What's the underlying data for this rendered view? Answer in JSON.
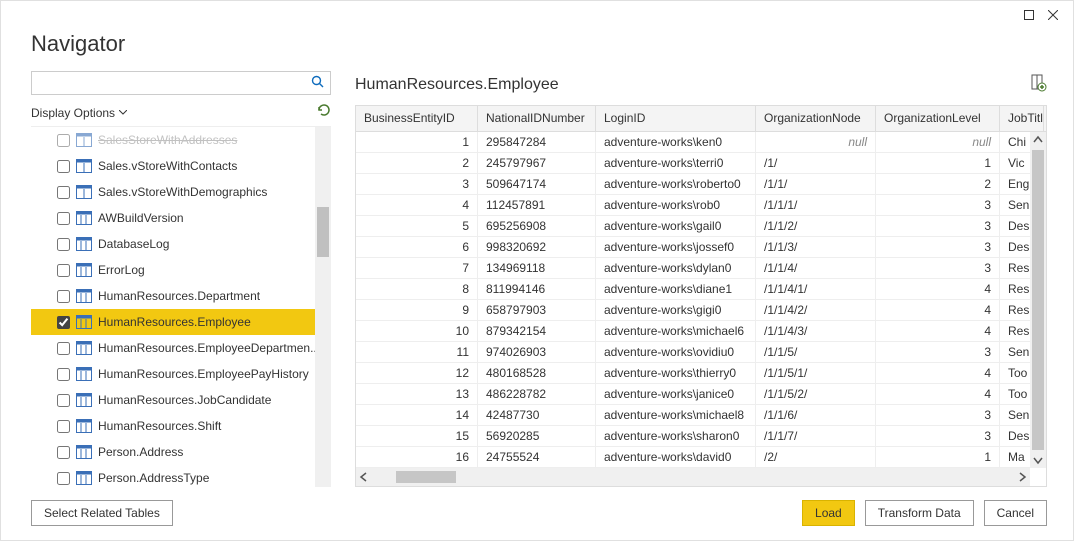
{
  "window": {
    "title": "Navigator"
  },
  "left": {
    "search_placeholder": "",
    "display_options": "Display Options",
    "tree": [
      {
        "label": "SalesStoreWithAddresses",
        "kind": "view",
        "checked": false,
        "faded": true
      },
      {
        "label": "Sales.vStoreWithContacts",
        "kind": "view",
        "checked": false
      },
      {
        "label": "Sales.vStoreWithDemographics",
        "kind": "view",
        "checked": false
      },
      {
        "label": "AWBuildVersion",
        "kind": "table",
        "checked": false
      },
      {
        "label": "DatabaseLog",
        "kind": "table",
        "checked": false
      },
      {
        "label": "ErrorLog",
        "kind": "table",
        "checked": false
      },
      {
        "label": "HumanResources.Department",
        "kind": "table",
        "checked": false
      },
      {
        "label": "HumanResources.Employee",
        "kind": "table",
        "checked": true,
        "selected": true
      },
      {
        "label": "HumanResources.EmployeeDepartmen...",
        "kind": "table",
        "checked": false
      },
      {
        "label": "HumanResources.EmployeePayHistory",
        "kind": "table",
        "checked": false
      },
      {
        "label": "HumanResources.JobCandidate",
        "kind": "table",
        "checked": false
      },
      {
        "label": "HumanResources.Shift",
        "kind": "table",
        "checked": false
      },
      {
        "label": "Person.Address",
        "kind": "table",
        "checked": false
      },
      {
        "label": "Person.AddressType",
        "kind": "table",
        "checked": false
      }
    ]
  },
  "preview": {
    "title": "HumanResources.Employee",
    "columns": [
      "BusinessEntityID",
      "NationalIDNumber",
      "LoginID",
      "OrganizationNode",
      "OrganizationLevel",
      "JobTitl"
    ],
    "rows": [
      {
        "id": "1",
        "nid": "295847284",
        "login": "adventure-works\\ken0",
        "node": "null",
        "level": "null",
        "job": "Chi"
      },
      {
        "id": "2",
        "nid": "245797967",
        "login": "adventure-works\\terri0",
        "node": "/1/",
        "level": "1",
        "job": "Vic"
      },
      {
        "id": "3",
        "nid": "509647174",
        "login": "adventure-works\\roberto0",
        "node": "/1/1/",
        "level": "2",
        "job": "Eng"
      },
      {
        "id": "4",
        "nid": "112457891",
        "login": "adventure-works\\rob0",
        "node": "/1/1/1/",
        "level": "3",
        "job": "Sen"
      },
      {
        "id": "5",
        "nid": "695256908",
        "login": "adventure-works\\gail0",
        "node": "/1/1/2/",
        "level": "3",
        "job": "Des"
      },
      {
        "id": "6",
        "nid": "998320692",
        "login": "adventure-works\\jossef0",
        "node": "/1/1/3/",
        "level": "3",
        "job": "Des"
      },
      {
        "id": "7",
        "nid": "134969118",
        "login": "adventure-works\\dylan0",
        "node": "/1/1/4/",
        "level": "3",
        "job": "Res"
      },
      {
        "id": "8",
        "nid": "811994146",
        "login": "adventure-works\\diane1",
        "node": "/1/1/4/1/",
        "level": "4",
        "job": "Res"
      },
      {
        "id": "9",
        "nid": "658797903",
        "login": "adventure-works\\gigi0",
        "node": "/1/1/4/2/",
        "level": "4",
        "job": "Res"
      },
      {
        "id": "10",
        "nid": "879342154",
        "login": "adventure-works\\michael6",
        "node": "/1/1/4/3/",
        "level": "4",
        "job": "Res"
      },
      {
        "id": "11",
        "nid": "974026903",
        "login": "adventure-works\\ovidiu0",
        "node": "/1/1/5/",
        "level": "3",
        "job": "Sen"
      },
      {
        "id": "12",
        "nid": "480168528",
        "login": "adventure-works\\thierry0",
        "node": "/1/1/5/1/",
        "level": "4",
        "job": "Too"
      },
      {
        "id": "13",
        "nid": "486228782",
        "login": "adventure-works\\janice0",
        "node": "/1/1/5/2/",
        "level": "4",
        "job": "Too"
      },
      {
        "id": "14",
        "nid": "42487730",
        "login": "adventure-works\\michael8",
        "node": "/1/1/6/",
        "level": "3",
        "job": "Sen"
      },
      {
        "id": "15",
        "nid": "56920285",
        "login": "adventure-works\\sharon0",
        "node": "/1/1/7/",
        "level": "3",
        "job": "Des"
      },
      {
        "id": "16",
        "nid": "24755524",
        "login": "adventure-works\\david0",
        "node": "/2/",
        "level": "1",
        "job": "Ma"
      }
    ]
  },
  "footer": {
    "select_related": "Select Related Tables",
    "load": "Load",
    "transform": "Transform Data",
    "cancel": "Cancel"
  }
}
